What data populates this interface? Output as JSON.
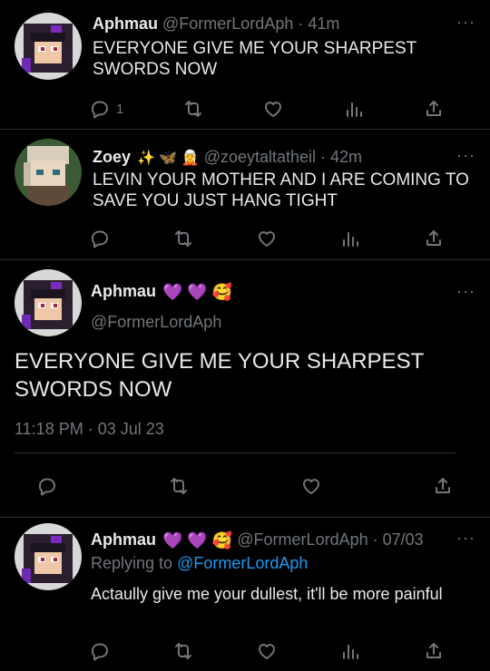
{
  "tweets": [
    {
      "name": "Aphmau",
      "handle": "@FormerLordAph · 41m",
      "text": "EVERYONE GIVE ME YOUR SHARPEST SWORDS NOW",
      "reply_count": "1"
    },
    {
      "name": "Zoey",
      "emoji": "✨ 🦋 🧝",
      "handle": "@zoeytaltatheil · 42m",
      "text": "LEVIN YOUR MOTHER AND I ARE COMING TO SAVE YOU JUST HANG TIGHT"
    }
  ],
  "main": {
    "name": "Aphmau",
    "emoji": "💜 💜 🥰",
    "handle": "@FormerLordAph",
    "text": "EVERYONE GIVE ME YOUR SHARPEST SWORDS NOW",
    "timestamp": "11:18 PM · 03 Jul 23"
  },
  "reply": {
    "name": "Aphmau",
    "emoji": "💜 💜 🥰",
    "handle": "@FormerLordAph · 07/03",
    "replying_label": "Replying to",
    "replying_handle": "@FormerLordAph",
    "text": "Actaully give me your dullest, it'll be more painful"
  },
  "more_label": "···",
  "colors": {
    "bg": "#000000",
    "text": "#e7e9ea",
    "muted": "#71767b",
    "link": "#1d9bf0",
    "divider": "#2f3336"
  },
  "icons": [
    "reply-icon",
    "retweet-icon",
    "like-icon",
    "views-icon",
    "share-icon"
  ]
}
